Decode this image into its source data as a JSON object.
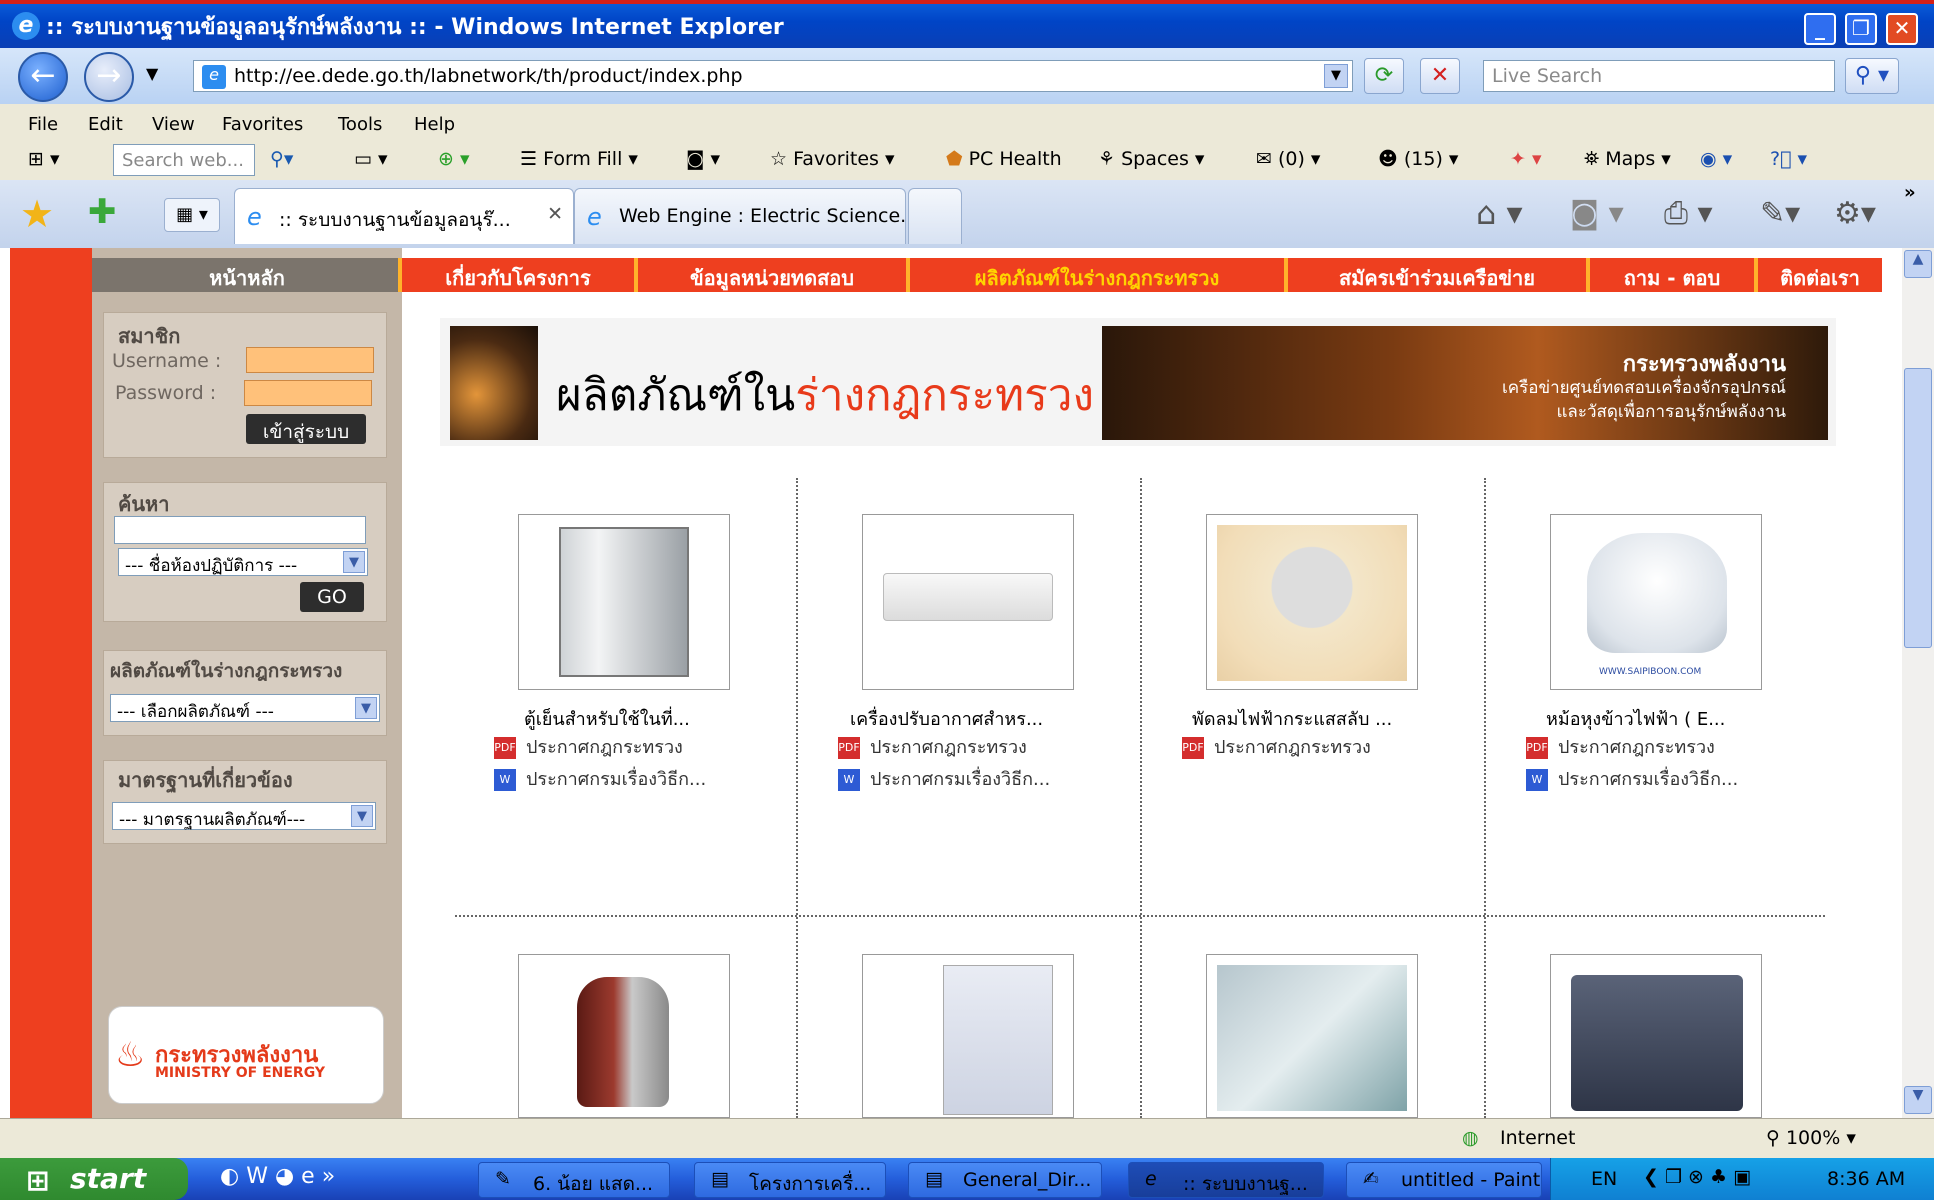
{
  "window": {
    "title": ":: ระบบงานฐานข้อมูลอนุรักษ์พลังงาน :: - Windows Internet Explorer"
  },
  "address": {
    "url": "http://ee.dede.go.th/labnetwork/th/product/index.php",
    "search_placeholder": "Live Search"
  },
  "menu": [
    "File",
    "Edit",
    "View",
    "Favorites",
    "Tools",
    "Help"
  ],
  "toolbar": {
    "search_placeholder": "Search web...",
    "form_fill": "Form Fill",
    "favorites": "Favorites",
    "pc_health": "PC Health",
    "spaces": "Spaces",
    "mail": "(0)",
    "contacts": "(15)",
    "maps": "Maps"
  },
  "tabs": [
    {
      "label": ":: ระบบงานฐานข้อมูลอนุร๊...",
      "active": true
    },
    {
      "label": "Web Engine : Electric Science...",
      "active": false
    }
  ],
  "page": {
    "nav_home": "หน้าหลัก",
    "nav": [
      {
        "label": "เกี่ยวกับโครงการ",
        "highlight": false
      },
      {
        "label": "ข้อมูลหน่วยทดสอบ",
        "highlight": false
      },
      {
        "label": "ผลิตภัณฑ์ในร่างกฎกระทรวง",
        "highlight": true
      },
      {
        "label": "สมัครเข้าร่วมเครือข่าย",
        "highlight": false
      },
      {
        "label": "ถาม - ตอบ",
        "highlight": false
      },
      {
        "label": "ติดต่อเรา",
        "highlight": false
      }
    ],
    "member": {
      "title": "สมาชิก",
      "username_label": "Username :",
      "password_label": "Password :",
      "login_button": "เข้าสู่ระบบ"
    },
    "search": {
      "title": "ค้นหา",
      "lab_select": "--- ชื่อห้องปฏิบัติการ ---",
      "go_button": "GO"
    },
    "products_box": {
      "title": "ผลิตภัณฑ์ในร่างกฎกระทรวง",
      "select": "--- เลือกผลิตภัณฑ์ ---"
    },
    "standards_box": {
      "title": "มาตรฐานที่เกี่ยวข้อง",
      "select": "--- มาตรฐานผลิตภัณฑ์---"
    },
    "banner": {
      "heading_black": "ผลิตภัณฑ์ใน",
      "heading_red": "ร่างกฎกระทรวง",
      "ministry": "กระทรวงพลังงาน",
      "line1": "เครือข่ายศูนย์ทดสอบเครื่องจักรอุปกรณ์",
      "line2": "และวัสดุเพื่อการอนุรักษ์พลังงาน"
    },
    "products": [
      {
        "name": "ตู้เย็นสำหรับใช้ในที่...",
        "link1": "ประกาศกฎกระทรวง",
        "link2": "ประกาศกรมเรื่องวิธีก...",
        "icon": "refrigerator-image"
      },
      {
        "name": "เครื่องปรับอากาศสำหร...",
        "link1": "ประกาศกฎกระทรวง",
        "link2": "ประกาศกรมเรื่องวิธีก...",
        "icon": "air-conditioner-image"
      },
      {
        "name": "พัดลมไฟฟ้ากระแสสลับ ...",
        "link1": "ประกาศกฎกระทรวง",
        "link2": "",
        "icon": "electric-fan-image"
      },
      {
        "name": "หม้อหุงข้าวไฟฟ้า ( E...",
        "link1": "ประกาศกฎกระทรวง",
        "link2": "ประกาศกรมเรื่องวิธีก...",
        "icon": "rice-cooker-image",
        "watermark": "WWW.SAIPIBOON.COM"
      }
    ],
    "products_row2_icons": [
      "electric-kettle-image",
      "water-heater-image",
      "glass-sheet-image",
      "chiller-image"
    ],
    "ministry_logo": {
      "thai": "กระทรวงพลังงาน",
      "english": "MINISTRY OF ENERGY"
    }
  },
  "status": {
    "zone": "Internet",
    "zoom": "100%"
  },
  "taskbar": {
    "start": "start",
    "tasks": [
      {
        "label": "6. น้อย แสด...",
        "active": false
      },
      {
        "label": "โครงการเครื่...",
        "active": false
      },
      {
        "label": "General_Dir...",
        "active": false
      },
      {
        "label": ":: ระบบงานฐ...",
        "active": true
      },
      {
        "label": "untitled - Paint",
        "active": false
      }
    ],
    "lang": "EN",
    "clock": "8:36 AM"
  },
  "colors": {
    "nav_red": "#ee3f1f",
    "nav_highlight": "#ffd400",
    "sidebar": "#c4b7a8",
    "xp_blue": "#245edb"
  }
}
